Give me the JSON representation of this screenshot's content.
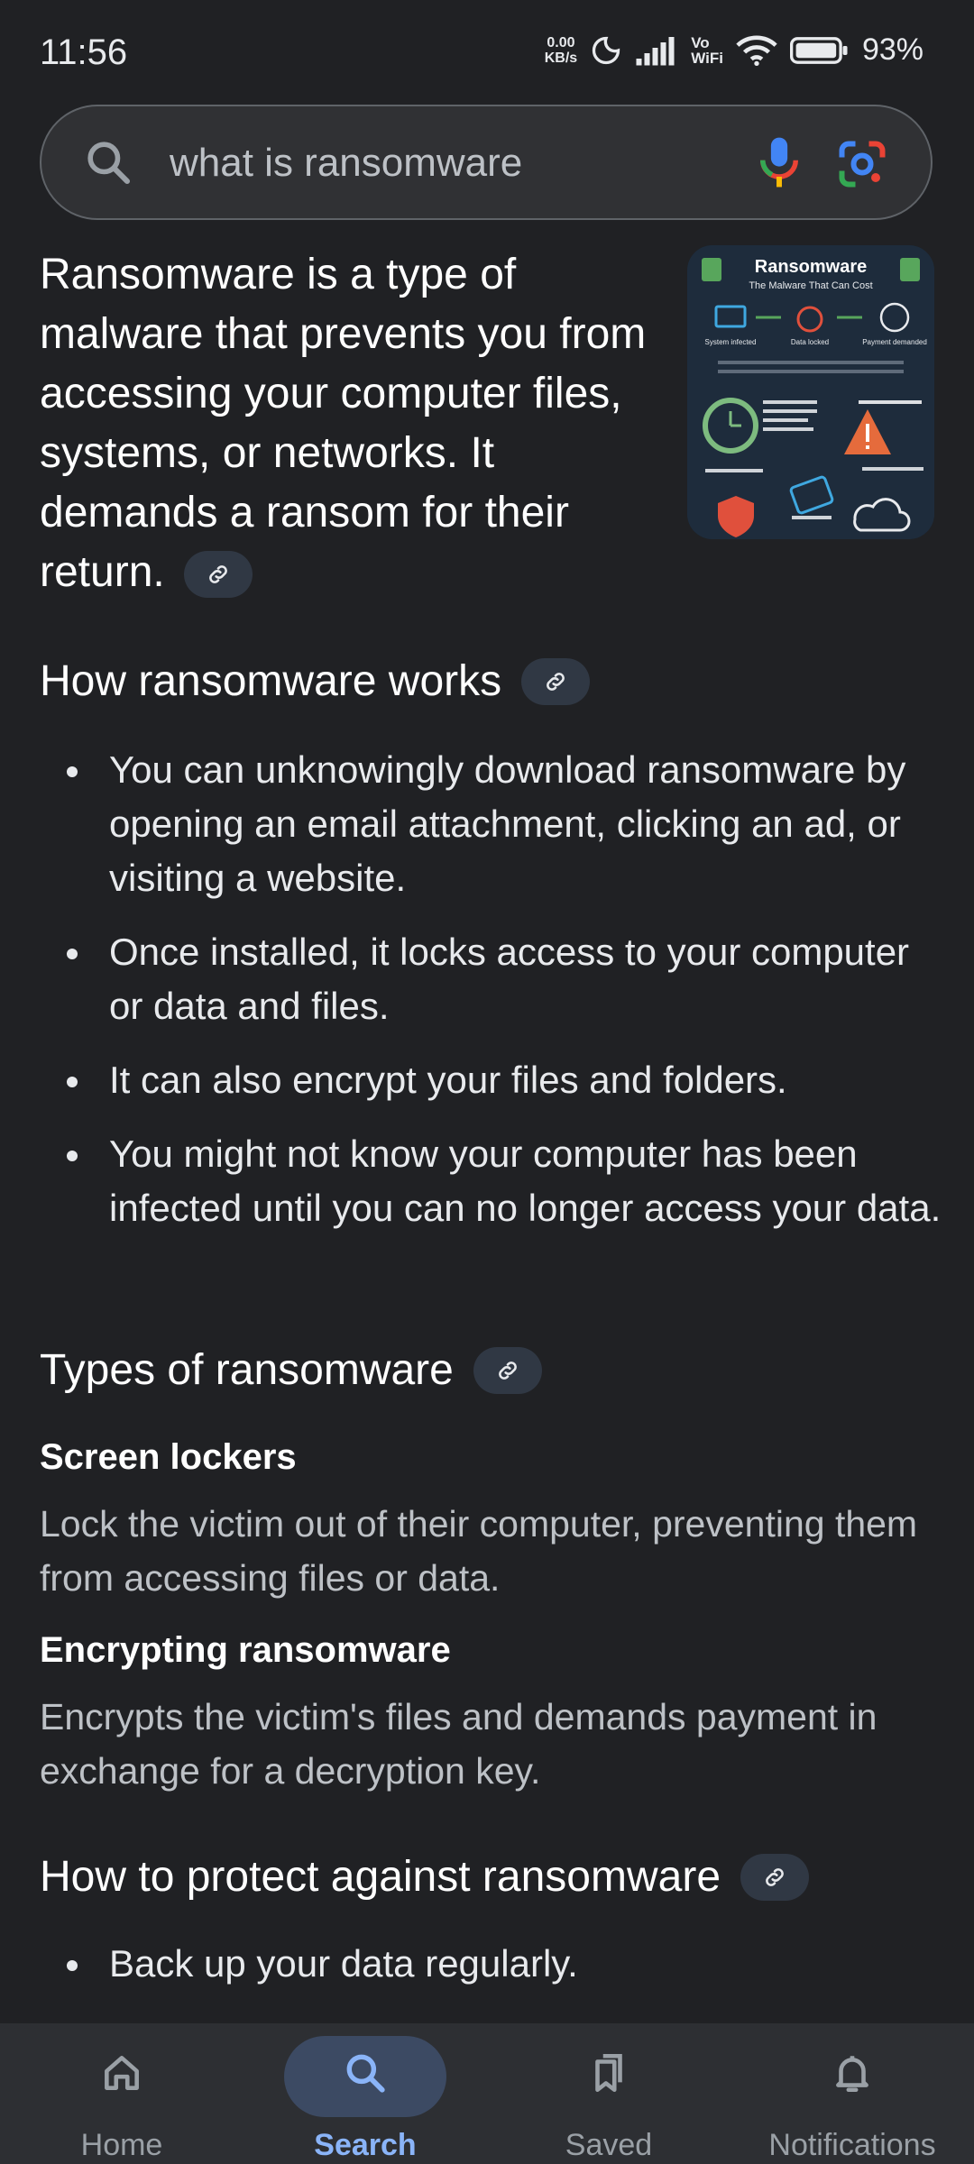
{
  "status": {
    "time": "11:56",
    "netspeed_value": "0.00",
    "netspeed_unit": "KB/s",
    "volte_top": "Vo",
    "volte_bottom": "WiFi",
    "battery": "93%"
  },
  "search": {
    "query": "what is ransomware"
  },
  "intro": {
    "text": "Ransomware is a type of malware that prevents you from accessing your computer files, systems, or networks. It demands a ransom for their return."
  },
  "thumbnail": {
    "title": "Ransomware",
    "subtitle": "The Malware That Can Cost",
    "steps": [
      "System infected",
      "Data locked",
      "Payment demanded"
    ],
    "stat_left": "Average time from infection to ransom demand",
    "stat_right": "£92million lost in NHS \"WannaCry\" attack",
    "tips": [
      "Always download security updates",
      "Never pay anything",
      "Be wary of unknown websites, emails or downloads"
    ]
  },
  "sections": {
    "how_works": {
      "title": "How ransomware works",
      "bullets": [
        "You can unknowingly download ransomware by opening an email attachment, clicking an ad, or visiting a website.",
        "Once installed, it locks access to your computer or data and files.",
        "It can also encrypt your files and folders.",
        "You might not know your computer has been infected until you can no longer access your data."
      ]
    },
    "types": {
      "title": "Types of ransomware",
      "items": [
        {
          "name": "Screen lockers",
          "desc": "Lock the victim out of their computer, preventing them from accessing files or data."
        },
        {
          "name": "Encrypting ransomware",
          "desc": "Encrypts the victim's files and demands payment in exchange for a decryption key."
        }
      ]
    },
    "protect": {
      "title": "How to protect against ransomware",
      "bullets": [
        "Back up your data regularly."
      ]
    }
  },
  "nav": {
    "items": [
      {
        "label": "Home",
        "icon": "home-icon"
      },
      {
        "label": "Search",
        "icon": "search-icon",
        "active": true
      },
      {
        "label": "Saved",
        "icon": "bookmarks-icon"
      },
      {
        "label": "Notifications",
        "icon": "bell-icon"
      }
    ]
  },
  "colors": {
    "background": "#202124",
    "accent": "#8ab4f8",
    "chip": "#303844"
  }
}
